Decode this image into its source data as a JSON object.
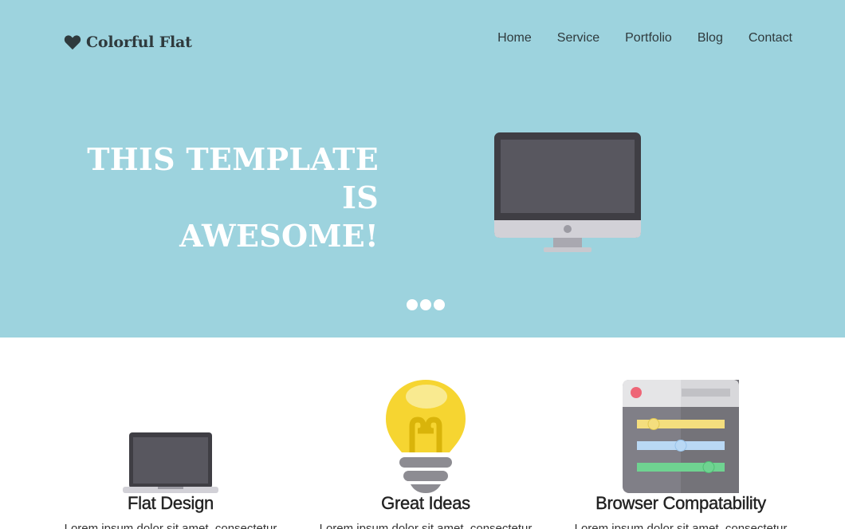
{
  "brand": {
    "name": "Colorful Flat",
    "icon": "heart-icon"
  },
  "nav": [
    {
      "label": "Home"
    },
    {
      "label": "Service"
    },
    {
      "label": "Portfolio"
    },
    {
      "label": "Blog"
    },
    {
      "label": "Contact"
    }
  ],
  "hero": {
    "title_line1": "THIS TEMPLATE IS",
    "title_line2": "AWESOME!",
    "image": "desktop-monitor-icon",
    "slider_dots": 3
  },
  "features": [
    {
      "title": "Flat Design",
      "icon": "laptop-icon",
      "text": "Lorem ipsum dolor sit amet, consectetur"
    },
    {
      "title": "Great Ideas",
      "icon": "lightbulb-icon",
      "text": "Lorem ipsum dolor sit amet, consectetur"
    },
    {
      "title": "Browser Compatability",
      "icon": "browser-settings-icon",
      "text": "Lorem ipsum dolor sit amet, consectetur"
    }
  ],
  "colors": {
    "hero_bg": "#9dd3de",
    "text_dark": "#2f3a3d",
    "white": "#ffffff"
  }
}
